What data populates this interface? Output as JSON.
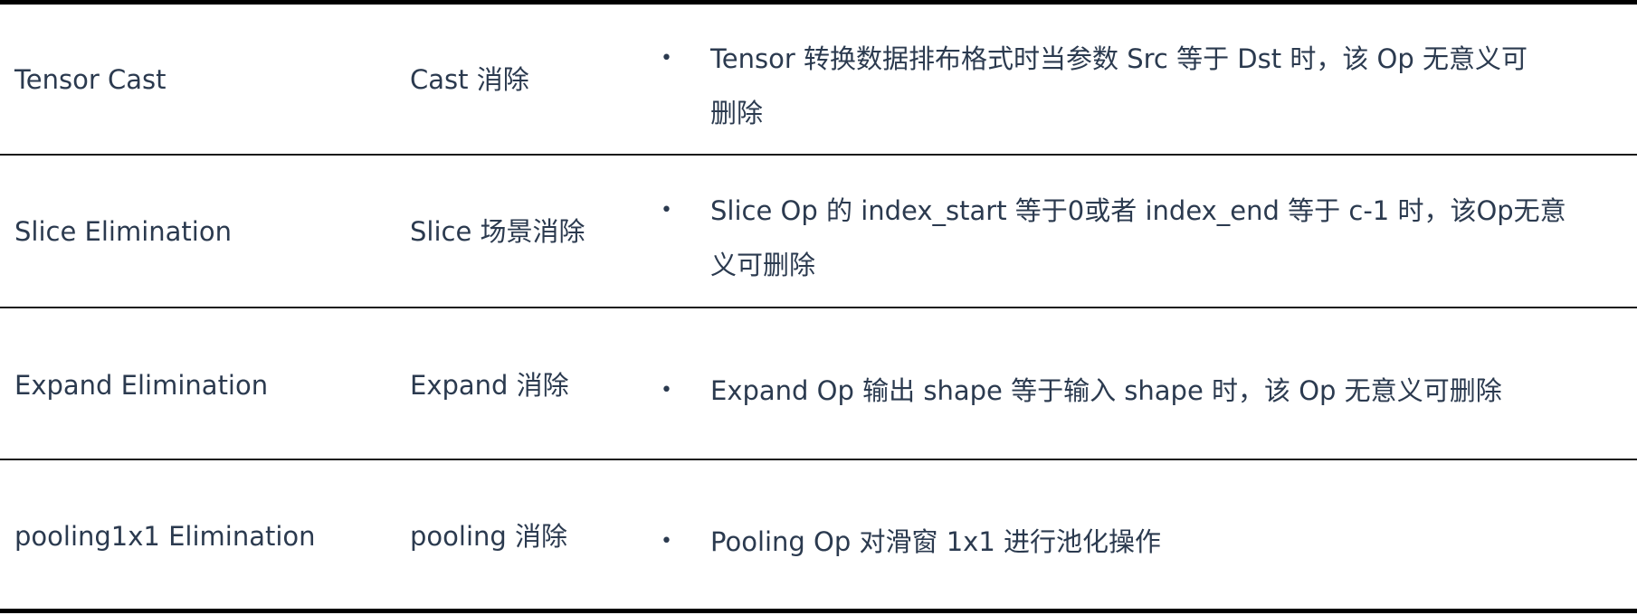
{
  "table": {
    "rows": [
      {
        "name": "Tensor Cast",
        "short": "Cast 消除",
        "bullet": "•",
        "desc_line1": "Tensor 转换数据排布格式时当参数 Src 等于 Dst 时，该 Op 无意义可",
        "desc_line2": "删除"
      },
      {
        "name": "Slice Elimination",
        "short": "Slice 场景消除",
        "bullet": "•",
        "desc_line1": "Slice Op 的 index_start 等于0或者 index_end 等于 c-1 时，该Op无意",
        "desc_line2": "义可删除"
      },
      {
        "name": "Expand Elimination",
        "short": "Expand 消除",
        "bullet": "•",
        "desc_line1": "Expand Op 输出 shape 等于输入 shape 时，该 Op 无意义可删除",
        "desc_line2": ""
      },
      {
        "name": "pooling1x1 Elimination",
        "short": "pooling 消除",
        "bullet": "•",
        "desc_line1": "Pooling Op 对滑窗 1x1 进行池化操作",
        "desc_line2": ""
      }
    ]
  }
}
